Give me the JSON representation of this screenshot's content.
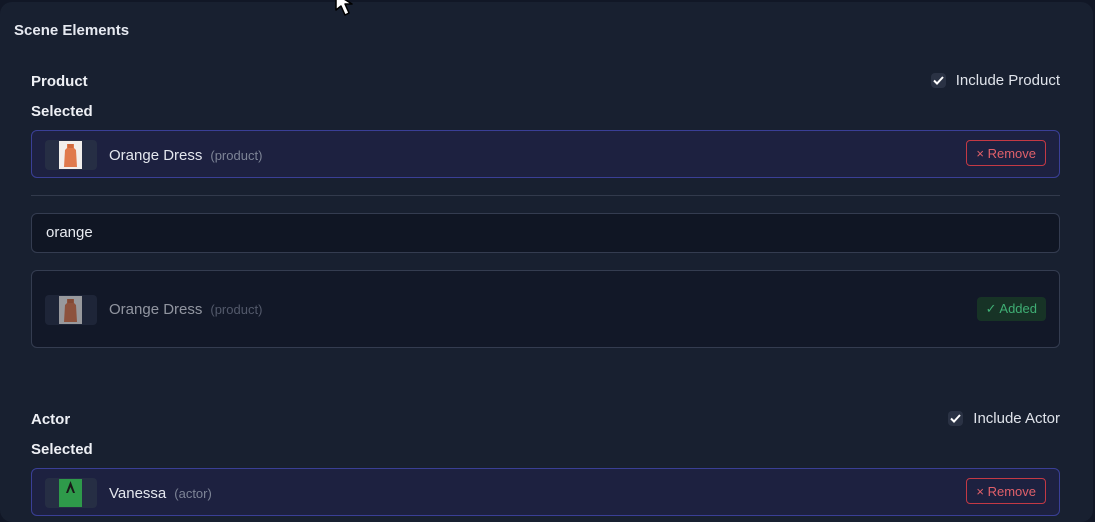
{
  "panel": {
    "title": "Scene Elements"
  },
  "product": {
    "heading": "Product",
    "include_label": "Include Product",
    "include_checked": true,
    "selected_label": "Selected",
    "selected_item": {
      "name": "Orange Dress",
      "type": "(product)",
      "remove_label": "× Remove"
    },
    "search": {
      "value": "orange"
    },
    "results": [
      {
        "name": "Orange Dress",
        "type": "(product)",
        "status_label": "✓ Added"
      }
    ]
  },
  "actor": {
    "heading": "Actor",
    "include_label": "Include Actor",
    "include_checked": true,
    "selected_label": "Selected",
    "selected_item": {
      "name": "Vanessa",
      "type": "(actor)",
      "remove_label": "× Remove"
    }
  },
  "colors": {
    "accent_border": "#3a3f96",
    "remove": "#c33945",
    "added": "#3fae74"
  }
}
